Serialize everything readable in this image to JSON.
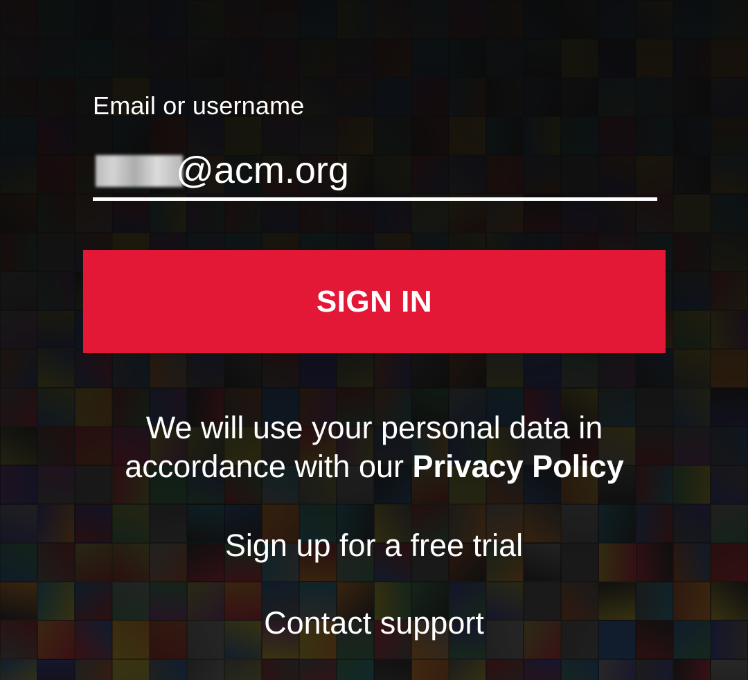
{
  "login": {
    "field_label": "Email or username",
    "field_value": "@acm.org",
    "sign_in_label": "SIGN IN"
  },
  "footer": {
    "privacy_text_line1": "We will use your personal data in",
    "privacy_text_line2": "accordance with our",
    "privacy_link": "Privacy Policy",
    "signup_link": "Sign up for a free trial",
    "support_link": "Contact support"
  },
  "colors": {
    "accent": "#e31837",
    "text": "#ffffff",
    "background": "#121212"
  }
}
